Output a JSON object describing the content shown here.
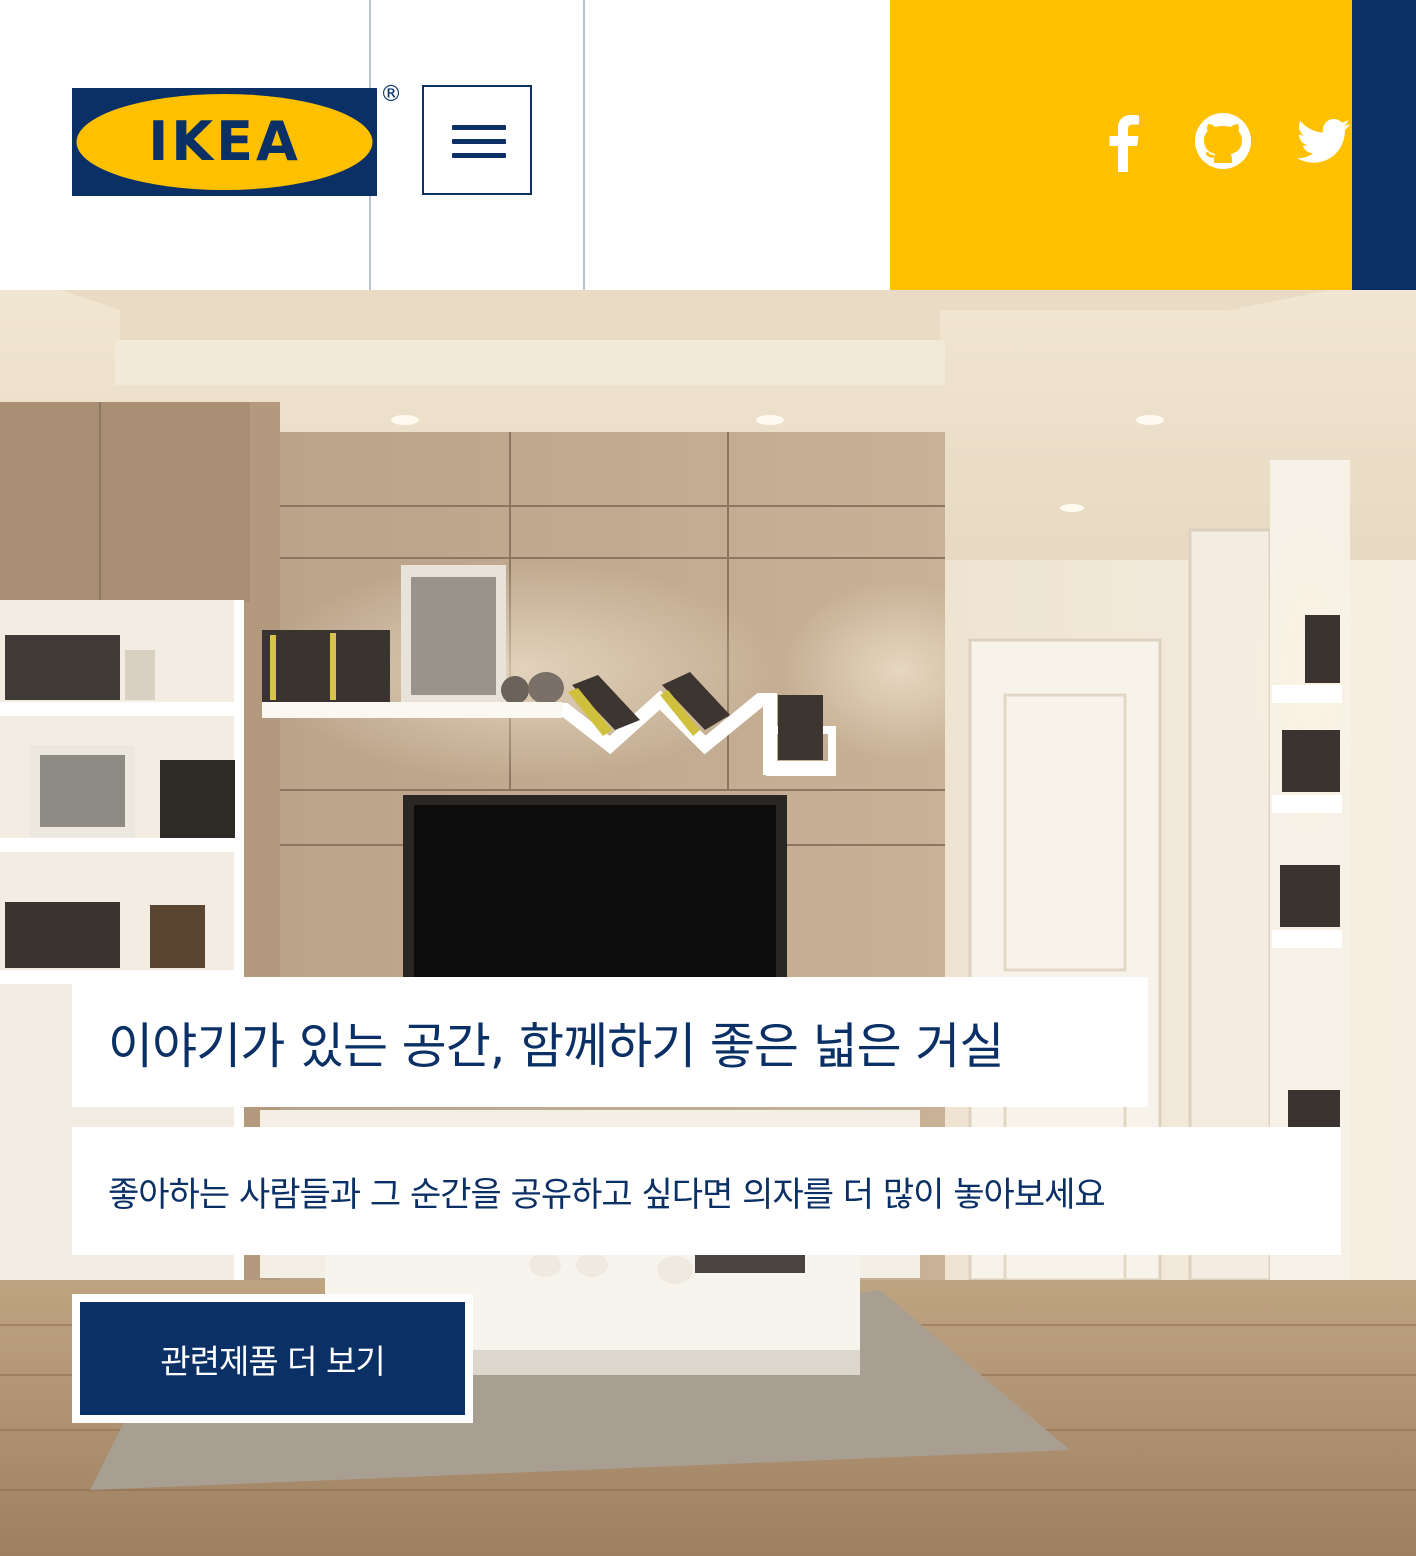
{
  "brand": {
    "logo_text": "IKEA",
    "registered_mark": "®",
    "colors": {
      "navy": "#0a3065",
      "yellow": "#ffc000",
      "white": "#ffffff"
    }
  },
  "header": {
    "menu_icon": "hamburger-menu-icon",
    "social": [
      {
        "icon": "facebook-icon"
      },
      {
        "icon": "github-icon"
      },
      {
        "icon": "twitter-icon"
      }
    ]
  },
  "hero": {
    "background": "living-room-interior-photo",
    "title": "이야기가 있는 공간, 함께하기 좋은 넓은 거실",
    "subtitle": "좋아하는 사람들과 그 순간을 공유하고 싶다면 의자를 더 많이 놓아보세요",
    "cta_label": "관련제품 더 보기"
  }
}
